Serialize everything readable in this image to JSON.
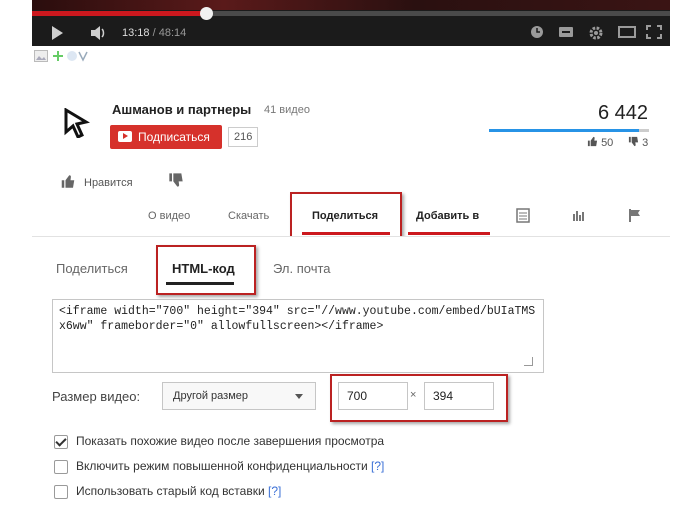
{
  "player": {
    "progress_fraction": 0.272,
    "time_current": "13:18",
    "time_separator": " / ",
    "time_total": "48:14"
  },
  "channel": {
    "name": "Ашманов и партнеры",
    "video_count": "41 видео",
    "subscribe_label": "Подписаться",
    "subscriber_count": "216",
    "view_count": "6 442",
    "likes": "50",
    "dislikes": "3",
    "rating_fraction": 0.94,
    "like_label": "Нравится"
  },
  "tabs": {
    "about": "О видео",
    "download": "Скачать",
    "share": "Поделиться",
    "add_to": "Добавить в"
  },
  "share": {
    "tabs": {
      "share": "Поделиться",
      "html_code": "HTML-код",
      "email": "Эл. почта"
    },
    "embed_code": "<iframe width=\"700\" height=\"394\" src=\"//www.youtube.com/embed/bUIaTMSx6ww\" frameborder=\"0\" allowfullscreen></iframe>",
    "size_label": "Размер видео:",
    "size_option": "Другой размер",
    "width": "700",
    "height": "394",
    "times": "×",
    "options": [
      {
        "label": "Показать похожие видео после завершения просмотра",
        "checked": true,
        "help": ""
      },
      {
        "label": "Включить режим повышенной конфиденциальности",
        "checked": false,
        "help": "[?]"
      },
      {
        "label": "Использовать старый код вставки",
        "checked": false,
        "help": "[?]"
      }
    ]
  },
  "colors": {
    "accent_red": "#cc181e",
    "subscribe_red": "#d6312b",
    "rating_blue": "#2793e6",
    "highlight": "#b22222"
  }
}
